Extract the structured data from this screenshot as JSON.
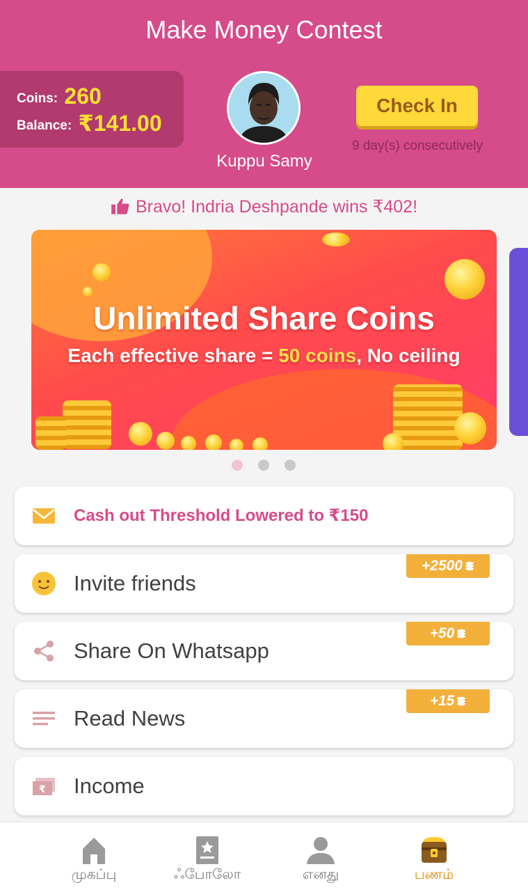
{
  "header": {
    "title": "Make Money Contest",
    "coins_label": "Coins:",
    "coins_value": "260",
    "balance_label": "Balance:",
    "balance_value": "₹141.00",
    "username": "Kuppu Samy",
    "checkin_label": "Check In",
    "streak_text": "9 day(s) consecutively"
  },
  "ticker": {
    "text": "Bravo! Indria Deshpande wins ₹402!",
    "icon": "thumbs-up-icon"
  },
  "banner": {
    "headline": "Unlimited Share Coins",
    "sub_prefix": "Each effective share = ",
    "sub_highlight": "50 coins",
    "sub_suffix": ", No ceiling",
    "page_count": 3,
    "active_page": 1
  },
  "notice": {
    "text": "Cash out Threshold Lowered to ₹150",
    "icon": "envelope-icon"
  },
  "tasks": [
    {
      "label": "Invite friends",
      "badge": "+2500",
      "icon": "smiley-icon"
    },
    {
      "label": "Share On Whatsapp",
      "badge": "+50",
      "icon": "share-icon"
    },
    {
      "label": "Read News",
      "badge": "+15",
      "icon": "news-lines-icon"
    },
    {
      "label": "Income",
      "badge": "",
      "icon": "rupee-note-icon"
    }
  ],
  "tabs": [
    {
      "label": "முகப்பு",
      "icon": "home-icon",
      "active": false
    },
    {
      "label": "ஃபோலோ",
      "icon": "bookmark-star-icon",
      "active": false
    },
    {
      "label": "எனது",
      "icon": "person-icon",
      "active": false
    },
    {
      "label": "பணம்",
      "icon": "treasure-chest-icon",
      "active": true
    }
  ],
  "colors": {
    "brand_pink": "#d64b8a",
    "balance_box": "#b23a6e",
    "coin_yellow": "#ffe033",
    "checkin_yellow": "#ffd93a",
    "badge_orange": "#f2b03b",
    "active_tab": "#e08a00"
  }
}
